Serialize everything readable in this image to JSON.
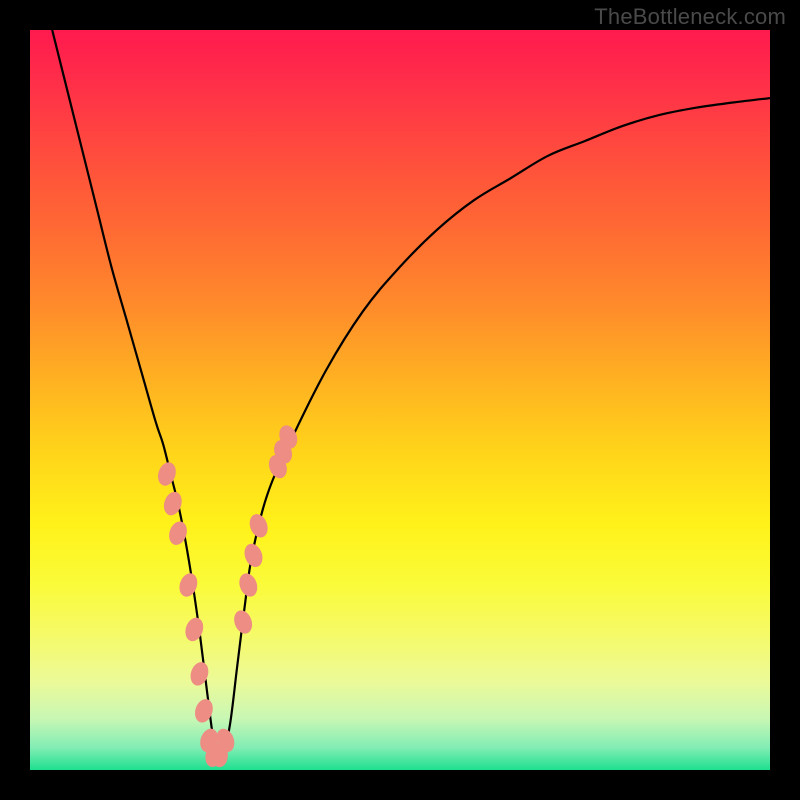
{
  "watermark": "TheBottleneck.com",
  "colors": {
    "curve_stroke": "#000000",
    "marker_fill": "#ee8d83",
    "background_black": "#000000"
  },
  "chart_data": {
    "type": "line",
    "title": "",
    "xlabel": "",
    "ylabel": "",
    "xlim": [
      0,
      100
    ],
    "ylim": [
      0,
      100
    ],
    "x": [
      3,
      5,
      7,
      9,
      11,
      13,
      15,
      17,
      18,
      19,
      20,
      21,
      22,
      23,
      24,
      25,
      26,
      27,
      28,
      29,
      30,
      32,
      35,
      40,
      45,
      50,
      55,
      60,
      65,
      70,
      75,
      80,
      85,
      90,
      95,
      100
    ],
    "y": [
      100,
      92,
      84,
      76,
      68,
      61,
      54,
      47,
      44,
      40,
      36,
      31,
      25,
      18,
      10,
      3,
      2,
      6,
      14,
      22,
      29,
      37,
      44,
      54,
      62,
      68,
      73,
      77,
      80,
      83,
      85,
      87,
      88.5,
      89.5,
      90.2,
      90.8
    ],
    "markers": {
      "x": [
        18.5,
        19.3,
        20.0,
        21.4,
        22.2,
        22.9,
        23.5,
        24.2,
        24.9,
        25.6,
        26.4,
        28.8,
        29.5,
        30.2,
        30.9,
        33.5,
        34.2,
        34.9
      ],
      "y": [
        40,
        36,
        32,
        25,
        19,
        13,
        8,
        4,
        2,
        2,
        4,
        20,
        25,
        29,
        33,
        41,
        43,
        45
      ]
    }
  }
}
